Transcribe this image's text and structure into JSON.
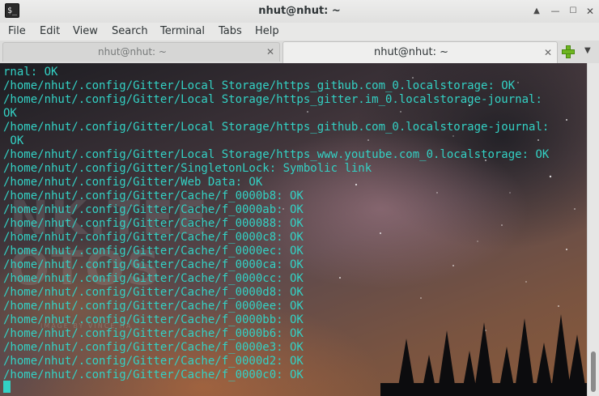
{
  "window": {
    "title": "nhut@nhut: ~",
    "app_icon_glyph": "$_",
    "controls": {
      "up_icon": "▲",
      "min_icon": "—",
      "max_icon": "☐",
      "close_icon": "✕"
    }
  },
  "menubar": {
    "items": [
      "File",
      "Edit",
      "View",
      "Search",
      "Terminal",
      "Tabs",
      "Help"
    ]
  },
  "tabs": [
    {
      "label": "nhut@nhut: ~",
      "close_icon": "✕",
      "active": false
    },
    {
      "label": "nhut@nhut: ~",
      "close_icon": "✕",
      "active": true
    }
  ],
  "tab_menu_icon": "▼",
  "terminal": {
    "text_color": "#33d1c4",
    "lines": [
      "rnal: OK",
      "/home/nhut/.config/Gitter/Local Storage/https_github.com_0.localstorage: OK",
      "/home/nhut/.config/Gitter/Local Storage/https_gitter.im_0.localstorage-journal:",
      "OK",
      "/home/nhut/.config/Gitter/Local Storage/https_github.com_0.localstorage-journal:",
      " OK",
      "/home/nhut/.config/Gitter/Local Storage/https_www.youtube.com_0.localstorage: OK",
      "/home/nhut/.config/Gitter/SingletonLock: Symbolic link",
      "/home/nhut/.config/Gitter/Web Data: OK",
      "/home/nhut/.config/Gitter/Cache/f_0000b8: OK",
      "/home/nhut/.config/Gitter/Cache/f_0000ab: OK",
      "/home/nhut/.config/Gitter/Cache/f_000088: OK",
      "/home/nhut/.config/Gitter/Cache/f_0000c8: OK",
      "/home/nhut/.config/Gitter/Cache/f_0000ec: OK",
      "/home/nhut/.config/Gitter/Cache/f_0000ca: OK",
      "/home/nhut/.config/Gitter/Cache/f_0000cc: OK",
      "/home/nhut/.config/Gitter/Cache/f_0000d8: OK",
      "/home/nhut/.config/Gitter/Cache/f_0000ee: OK",
      "/home/nhut/.config/Gitter/Cache/f_0000bb: OK",
      "/home/nhut/.config/Gitter/Cache/f_0000b6: OK",
      "/home/nhut/.config/Gitter/Cache/f_0000e3: OK",
      "/home/nhut/.config/Gitter/Cache/f_0000d2: OK",
      "/home/nhut/.config/Gitter/Cache/f_0000c0: OK"
    ],
    "watermark": "NK.TEE\nOTOS",
    "watermark_small": "IMAGE BY VINCE HA"
  }
}
